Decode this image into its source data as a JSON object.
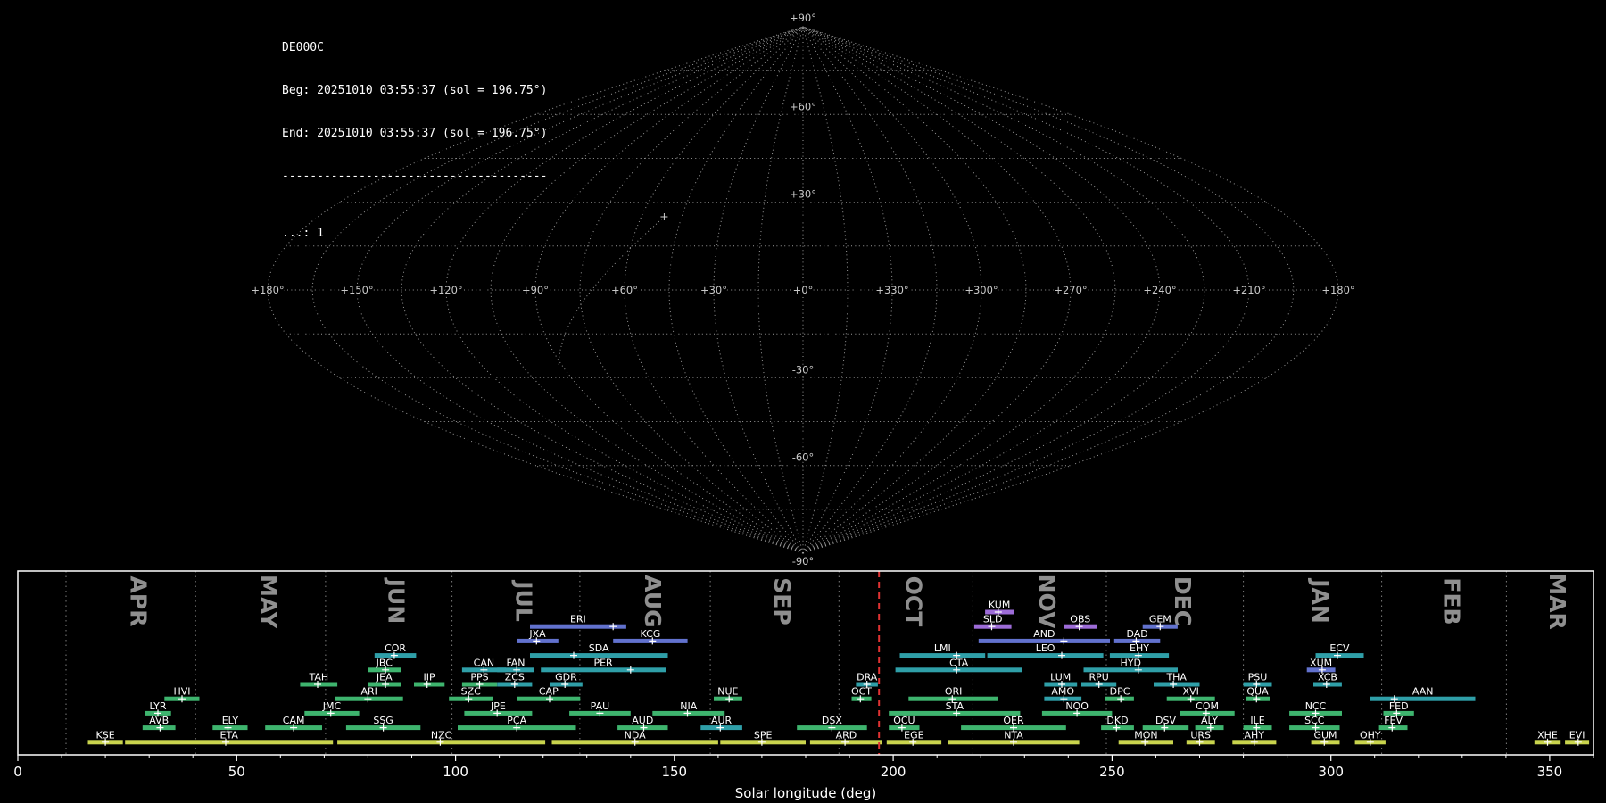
{
  "header": {
    "station": "DE000C",
    "beg_line": "Beg: 20251010 03:55:37 (sol = 196.75°)",
    "end_line": "End: 20251010 03:55:37 (sol = 196.75°)",
    "divider": "--------------------------------------",
    "count_line": "...: 1"
  },
  "colors": {
    "background": "#000000",
    "grid": "#ababab",
    "map_label": "#c9c9c9",
    "month_label": "#8f8f8f",
    "month_line": "#7d7d7d",
    "current_sol_line": "#e03232",
    "bar_yellow": "#c9d44d",
    "bar_green": "#3eb46e",
    "bar_teal": "#2f9fa8",
    "bar_blue": "#6272ce",
    "bar_purple": "#9d6cd8"
  },
  "skymap": {
    "lat_step": 15,
    "lon_step": 15,
    "lon_labels": [
      {
        "text": "+180°",
        "offset": 180
      },
      {
        "text": "+150°",
        "offset": 150
      },
      {
        "text": "+120°",
        "offset": 120
      },
      {
        "text": "+90°",
        "offset": 90
      },
      {
        "text": "+60°",
        "offset": 60
      },
      {
        "text": "+30°",
        "offset": 30
      },
      {
        "text": "+0°",
        "offset": 0
      },
      {
        "text": "+330°",
        "offset": -30
      },
      {
        "text": "+300°",
        "offset": -60
      },
      {
        "text": "+270°",
        "offset": -90
      },
      {
        "text": "+240°",
        "offset": -120
      },
      {
        "text": "+210°",
        "offset": -150
      },
      {
        "text": "+180°",
        "offset": -180
      }
    ],
    "lat_labels": [
      {
        "text": "+90°",
        "lat": 90
      },
      {
        "text": "+60°",
        "lat": 60
      },
      {
        "text": "+30°",
        "lat": 30
      },
      {
        "text": "-30°",
        "lat": -30
      },
      {
        "text": "-60°",
        "lat": -60
      },
      {
        "text": "-90°",
        "lat": -90
      }
    ],
    "trail": {
      "from_lon": 91,
      "from_lat": -25.5,
      "to_lon": 51.5,
      "to_lat": 25
    }
  },
  "chart_data": {
    "type": "timeline",
    "title": "",
    "xlabel": "Solar longitude (deg)",
    "xlim": [
      0,
      360
    ],
    "xticks": [
      0,
      50,
      100,
      150,
      200,
      250,
      300,
      350
    ],
    "current_sol": 196.75,
    "lanes": 10,
    "months": [
      {
        "label": "APR",
        "start": 11.0,
        "end": 40.6
      },
      {
        "label": "MAY",
        "start": 40.6,
        "end": 70.3
      },
      {
        "label": "JUN",
        "start": 70.3,
        "end": 99.2
      },
      {
        "label": "JUL",
        "start": 99.2,
        "end": 128.4
      },
      {
        "label": "AUG",
        "start": 128.4,
        "end": 158.2
      },
      {
        "label": "SEP",
        "start": 158.2,
        "end": 187.6
      },
      {
        "label": "OCT",
        "start": 187.6,
        "end": 218.2
      },
      {
        "label": "NOV",
        "start": 218.2,
        "end": 248.7
      },
      {
        "label": "DEC",
        "start": 248.7,
        "end": 280.0
      },
      {
        "label": "JAN",
        "start": 280.0,
        "end": 311.6
      },
      {
        "label": "FEB",
        "start": 311.6,
        "end": 340.1
      },
      {
        "label": "MAR",
        "start": 340.1,
        "end": 360.0
      }
    ],
    "showers": [
      {
        "code": "KUM",
        "start": 221,
        "end": 227.5,
        "peak": 224,
        "lane": 0,
        "color": "purple"
      },
      {
        "code": "ERI",
        "start": 117,
        "end": 139,
        "peak": 136,
        "lane": 1,
        "color": "blue"
      },
      {
        "code": "SLD",
        "start": 218.5,
        "end": 227,
        "peak": 222.5,
        "lane": 1,
        "color": "purple"
      },
      {
        "code": "OBS",
        "start": 239,
        "end": 246.5,
        "peak": 242.5,
        "lane": 1,
        "color": "purple"
      },
      {
        "code": "GEM",
        "start": 257,
        "end": 265,
        "peak": 261,
        "lane": 1,
        "color": "blue"
      },
      {
        "code": "JXA",
        "start": 114,
        "end": 123.5,
        "peak": 118.5,
        "lane": 2,
        "color": "blue"
      },
      {
        "code": "KCG",
        "start": 136,
        "end": 153,
        "peak": 145,
        "lane": 2,
        "color": "blue"
      },
      {
        "code": "AND",
        "start": 219.5,
        "end": 249.5,
        "peak": 239,
        "lane": 2,
        "color": "blue"
      },
      {
        "code": "DAD",
        "start": 250.5,
        "end": 261,
        "peak": 255.5,
        "lane": 2,
        "color": "blue"
      },
      {
        "code": "COR",
        "start": 81.5,
        "end": 91,
        "peak": 86,
        "lane": 3,
        "color": "teal"
      },
      {
        "code": "SDA",
        "start": 117,
        "end": 148.5,
        "peak": 127,
        "lane": 3,
        "color": "teal"
      },
      {
        "code": "LMI",
        "start": 201.5,
        "end": 221,
        "peak": 214.5,
        "lane": 3,
        "color": "teal"
      },
      {
        "code": "LEO",
        "start": 221.5,
        "end": 248,
        "peak": 238.5,
        "lane": 3,
        "color": "teal"
      },
      {
        "code": "EHY",
        "start": 249.5,
        "end": 263,
        "peak": 256,
        "lane": 3,
        "color": "teal"
      },
      {
        "code": "ECV",
        "start": 296.5,
        "end": 307.5,
        "peak": 301.5,
        "lane": 3,
        "color": "teal"
      },
      {
        "code": "JBC",
        "start": 80,
        "end": 87.5,
        "peak": 84,
        "lane": 4,
        "color": "green"
      },
      {
        "code": "CAN",
        "start": 101.5,
        "end": 111.5,
        "peak": 106.5,
        "lane": 4,
        "color": "teal"
      },
      {
        "code": "FAN",
        "start": 109.5,
        "end": 118,
        "peak": 114,
        "lane": 4,
        "color": "teal"
      },
      {
        "code": "PER",
        "start": 119.5,
        "end": 148,
        "peak": 140,
        "lane": 4,
        "color": "teal"
      },
      {
        "code": "CTA",
        "start": 200.5,
        "end": 229.5,
        "peak": 214.5,
        "lane": 4,
        "color": "teal"
      },
      {
        "code": "HYD",
        "start": 243.5,
        "end": 265,
        "peak": 256,
        "lane": 4,
        "color": "teal"
      },
      {
        "code": "XUM",
        "start": 294.5,
        "end": 301,
        "peak": 298,
        "lane": 4,
        "color": "blue"
      },
      {
        "code": "TAH",
        "start": 64.5,
        "end": 73,
        "peak": 68.5,
        "lane": 5,
        "color": "green"
      },
      {
        "code": "JEA",
        "start": 80,
        "end": 87.5,
        "peak": 84,
        "lane": 5,
        "color": "green"
      },
      {
        "code": "IIP",
        "start": 90.5,
        "end": 97.5,
        "peak": 93.5,
        "lane": 5,
        "color": "green"
      },
      {
        "code": "PPS",
        "start": 101.5,
        "end": 109.5,
        "peak": 105.5,
        "lane": 5,
        "color": "green"
      },
      {
        "code": "ZCS",
        "start": 109.5,
        "end": 117.5,
        "peak": 113.5,
        "lane": 5,
        "color": "teal"
      },
      {
        "code": "GDR",
        "start": 121.5,
        "end": 129,
        "peak": 125,
        "lane": 5,
        "color": "teal"
      },
      {
        "code": "DRA",
        "start": 191.5,
        "end": 196.5,
        "peak": 194,
        "lane": 5,
        "color": "teal"
      },
      {
        "code": "LUM",
        "start": 234.5,
        "end": 242,
        "peak": 238.5,
        "lane": 5,
        "color": "teal"
      },
      {
        "code": "RPU",
        "start": 243,
        "end": 251,
        "peak": 247,
        "lane": 5,
        "color": "teal"
      },
      {
        "code": "THA",
        "start": 259.5,
        "end": 270,
        "peak": 264,
        "lane": 5,
        "color": "teal"
      },
      {
        "code": "PSU",
        "start": 280,
        "end": 286.5,
        "peak": 283,
        "lane": 5,
        "color": "teal"
      },
      {
        "code": "XCB",
        "start": 296,
        "end": 302.5,
        "peak": 299,
        "lane": 5,
        "color": "teal"
      },
      {
        "code": "HVI",
        "start": 33.5,
        "end": 41.5,
        "peak": 37.5,
        "lane": 6,
        "color": "green"
      },
      {
        "code": "ARI",
        "start": 72.5,
        "end": 88,
        "peak": 80,
        "lane": 6,
        "color": "green"
      },
      {
        "code": "SZC",
        "start": 98.5,
        "end": 108.5,
        "peak": 103,
        "lane": 6,
        "color": "green"
      },
      {
        "code": "CAP",
        "start": 114,
        "end": 128.5,
        "peak": 121.5,
        "lane": 6,
        "color": "green"
      },
      {
        "code": "NUE",
        "start": 159,
        "end": 165.5,
        "peak": 162.5,
        "lane": 6,
        "color": "green"
      },
      {
        "code": "OCT",
        "start": 190.5,
        "end": 195,
        "peak": 192.5,
        "lane": 6,
        "color": "green"
      },
      {
        "code": "ORI",
        "start": 203.5,
        "end": 224,
        "peak": 213.5,
        "lane": 6,
        "color": "green"
      },
      {
        "code": "AMO",
        "start": 234.5,
        "end": 243,
        "peak": 239,
        "lane": 6,
        "color": "teal"
      },
      {
        "code": "DPC",
        "start": 248.5,
        "end": 255,
        "peak": 252,
        "lane": 6,
        "color": "green"
      },
      {
        "code": "XVI",
        "start": 262.5,
        "end": 273.5,
        "peak": 268,
        "lane": 6,
        "color": "green"
      },
      {
        "code": "QUA",
        "start": 280.5,
        "end": 286,
        "peak": 283,
        "lane": 6,
        "color": "green"
      },
      {
        "code": "AAN",
        "start": 309,
        "end": 333,
        "peak": 314.5,
        "lane": 6,
        "color": "teal"
      },
      {
        "code": "LYR",
        "start": 29,
        "end": 35,
        "peak": 32,
        "lane": 7,
        "color": "green"
      },
      {
        "code": "JMC",
        "start": 65.5,
        "end": 78,
        "peak": 71.5,
        "lane": 7,
        "color": "green"
      },
      {
        "code": "JPE",
        "start": 102,
        "end": 117.5,
        "peak": 109.5,
        "lane": 7,
        "color": "green"
      },
      {
        "code": "PAU",
        "start": 126,
        "end": 140,
        "peak": 133,
        "lane": 7,
        "color": "green"
      },
      {
        "code": "NIA",
        "start": 145,
        "end": 161.5,
        "peak": 153,
        "lane": 7,
        "color": "green"
      },
      {
        "code": "STA",
        "start": 199,
        "end": 229,
        "peak": 214.5,
        "lane": 7,
        "color": "green"
      },
      {
        "code": "NOO",
        "start": 234,
        "end": 250,
        "peak": 242,
        "lane": 7,
        "color": "green"
      },
      {
        "code": "COM",
        "start": 265.5,
        "end": 278,
        "peak": 271.5,
        "lane": 7,
        "color": "green"
      },
      {
        "code": "NCC",
        "start": 290.5,
        "end": 302.5,
        "peak": 296.5,
        "lane": 7,
        "color": "green"
      },
      {
        "code": "FED",
        "start": 312,
        "end": 319,
        "peak": 315,
        "lane": 7,
        "color": "green"
      },
      {
        "code": "AVB",
        "start": 28.5,
        "end": 36,
        "peak": 32.5,
        "lane": 8,
        "color": "green"
      },
      {
        "code": "ELY",
        "start": 44.5,
        "end": 52.5,
        "peak": 48,
        "lane": 8,
        "color": "green"
      },
      {
        "code": "CAM",
        "start": 56.5,
        "end": 69.5,
        "peak": 63,
        "lane": 8,
        "color": "green"
      },
      {
        "code": "SSG",
        "start": 75,
        "end": 92,
        "peak": 83.5,
        "lane": 8,
        "color": "green"
      },
      {
        "code": "PCA",
        "start": 100.5,
        "end": 127.5,
        "peak": 114,
        "lane": 8,
        "color": "green"
      },
      {
        "code": "AUD",
        "start": 137,
        "end": 148.5,
        "peak": 143,
        "lane": 8,
        "color": "green"
      },
      {
        "code": "AUR",
        "start": 156,
        "end": 165.5,
        "peak": 160.5,
        "lane": 8,
        "color": "teal"
      },
      {
        "code": "DSX",
        "start": 178,
        "end": 194,
        "peak": 186,
        "lane": 8,
        "color": "green"
      },
      {
        "code": "OCU",
        "start": 199,
        "end": 206,
        "peak": 202,
        "lane": 8,
        "color": "green"
      },
      {
        "code": "OER",
        "start": 215.5,
        "end": 239.5,
        "peak": 227.5,
        "lane": 8,
        "color": "green"
      },
      {
        "code": "DKD",
        "start": 247.5,
        "end": 255,
        "peak": 251,
        "lane": 8,
        "color": "green"
      },
      {
        "code": "DSV",
        "start": 257,
        "end": 267.5,
        "peak": 262,
        "lane": 8,
        "color": "green"
      },
      {
        "code": "ALY",
        "start": 269,
        "end": 275.5,
        "peak": 272.5,
        "lane": 8,
        "color": "green"
      },
      {
        "code": "ILE",
        "start": 280,
        "end": 286.5,
        "peak": 283,
        "lane": 8,
        "color": "green"
      },
      {
        "code": "SCC",
        "start": 290.5,
        "end": 302,
        "peak": 296.5,
        "lane": 8,
        "color": "green"
      },
      {
        "code": "FEV",
        "start": 311,
        "end": 317.5,
        "peak": 314,
        "lane": 8,
        "color": "green"
      },
      {
        "code": "KSE",
        "start": 16,
        "end": 24,
        "peak": 20,
        "lane": 9,
        "color": "yellow"
      },
      {
        "code": "ETA",
        "start": 24.5,
        "end": 72,
        "peak": 47.5,
        "lane": 9,
        "color": "yellow"
      },
      {
        "code": "NZC",
        "start": 73,
        "end": 120.5,
        "peak": 96.5,
        "lane": 9,
        "color": "yellow"
      },
      {
        "code": "NDA",
        "start": 122,
        "end": 160,
        "peak": 141,
        "lane": 9,
        "color": "yellow"
      },
      {
        "code": "SPE",
        "start": 160.5,
        "end": 180,
        "peak": 170,
        "lane": 9,
        "color": "yellow"
      },
      {
        "code": "ARD",
        "start": 181,
        "end": 197.5,
        "peak": 189,
        "lane": 9,
        "color": "yellow"
      },
      {
        "code": "EGE",
        "start": 198.5,
        "end": 211,
        "peak": 204.5,
        "lane": 9,
        "color": "yellow"
      },
      {
        "code": "NTA",
        "start": 212.5,
        "end": 242.5,
        "peak": 227.5,
        "lane": 9,
        "color": "yellow"
      },
      {
        "code": "MON",
        "start": 251.5,
        "end": 264,
        "peak": 257.5,
        "lane": 9,
        "color": "yellow"
      },
      {
        "code": "URS",
        "start": 267,
        "end": 273.5,
        "peak": 270,
        "lane": 9,
        "color": "yellow"
      },
      {
        "code": "AHY",
        "start": 277.5,
        "end": 287.5,
        "peak": 282.5,
        "lane": 9,
        "color": "yellow"
      },
      {
        "code": "GUM",
        "start": 295.5,
        "end": 302,
        "peak": 298.5,
        "lane": 9,
        "color": "yellow"
      },
      {
        "code": "OHY",
        "start": 305.5,
        "end": 312.5,
        "peak": 309,
        "lane": 9,
        "color": "yellow"
      },
      {
        "code": "XHE",
        "start": 346.5,
        "end": 352.5,
        "peak": 349.5,
        "lane": 9,
        "color": "yellow"
      },
      {
        "code": "EVI",
        "start": 353.5,
        "end": 359,
        "peak": 356.5,
        "lane": 9,
        "color": "yellow"
      }
    ]
  }
}
